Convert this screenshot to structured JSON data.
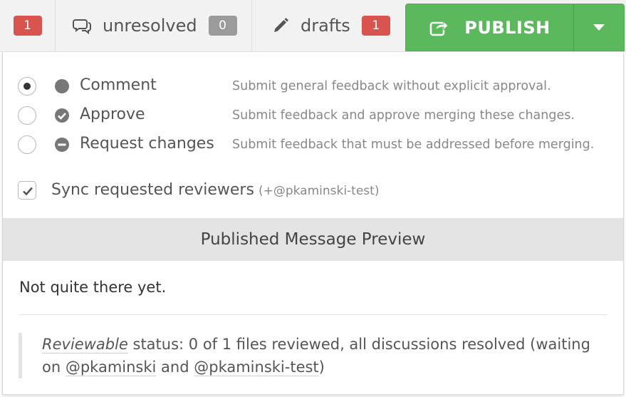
{
  "toolbar": {
    "counter_badge": "1",
    "unresolved": {
      "label": "unresolved",
      "count": "0",
      "icon": "comments-icon"
    },
    "drafts": {
      "label": "drafts",
      "count": "1",
      "icon": "pencil-icon"
    },
    "publish": {
      "label": "PUBLISH",
      "icon": "share-icon",
      "dropdown_icon": "caret-down-icon"
    }
  },
  "review_options": [
    {
      "label": "Comment",
      "description": "Submit general feedback without explicit approval.",
      "selected": true,
      "icon": "circle-icon"
    },
    {
      "label": "Approve",
      "description": "Submit feedback and approve merging these changes.",
      "selected": false,
      "icon": "check-circle-icon"
    },
    {
      "label": "Request changes",
      "description": "Submit feedback that must be addressed before merging.",
      "selected": false,
      "icon": "minus-circle-icon"
    }
  ],
  "sync": {
    "label": "Sync requested reviewers",
    "extra": "(+@pkaminski-test)",
    "checked": true
  },
  "preview": {
    "title": "Published Message Preview",
    "message": "Not quite there yet.",
    "status_link": "Reviewable",
    "status_text": " status: 0 of 1 files reviewed, all discussions resolved (waiting on ",
    "user1": "@pkaminski",
    "and_text": " and ",
    "user2": "@pkaminski-test",
    "close_text": ")"
  },
  "colors": {
    "publish_green": "#5cb85c",
    "badge_red": "#d9534f",
    "badge_gray": "#9b9b9b",
    "preview_bar": "#e4e4e4"
  }
}
